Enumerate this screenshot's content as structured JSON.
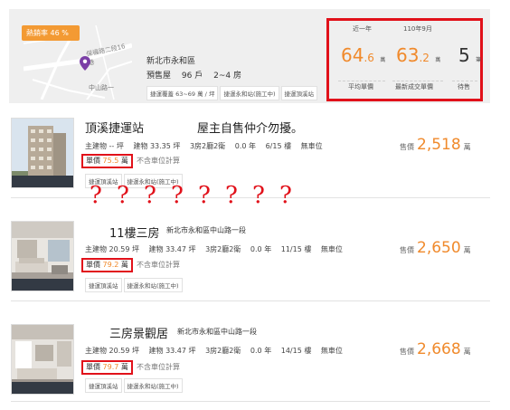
{
  "header": {
    "heat_rate": "熱銷率 46 %",
    "map_road_1": "中山路一",
    "map_road_2": "保福路二段16巷",
    "community_name": "新北市永和區",
    "community_info": [
      "預售屋",
      "96 戶",
      "2~4 房"
    ],
    "community_tags": [
      "捷運覆蓋 63~69 萬 / 坪",
      "捷運永和站(施工中)",
      "捷運頂溪站"
    ],
    "stats": {
      "period_year": "近一年",
      "period_month": "110年9月",
      "avg_price_int": "64",
      "avg_price_dec": ".6",
      "avg_price_unit": "萬",
      "avg_price_label": "平均單價",
      "latest_price_int": "63",
      "latest_price_dec": ".2",
      "latest_price_unit": "萬",
      "latest_price_label": "最新成交單價",
      "for_sale_count": "5",
      "for_sale_unit": "筆",
      "for_sale_label": "待售"
    }
  },
  "question_marks": [
    "?",
    "?",
    "?",
    "?",
    "?",
    "?",
    "?",
    "?"
  ],
  "listings": [
    {
      "title": "頂溪捷運站",
      "subtitle": "屋主自售仲介勿擾。",
      "address": "",
      "specs": [
        "主建物 -- 坪",
        "建物 33.35 坪",
        "3房2廳2衛",
        "0.0 年",
        "6/15 樓",
        "無車位"
      ],
      "unit_price_label": "單價",
      "unit_price_value": "75.5",
      "unit_price_unit": "萬",
      "exclude_note": "不含車位計算",
      "tags": [
        "捷運頂溪站",
        "捷運永和站(施工中)"
      ],
      "price_prefix": "售價",
      "price": "2,518",
      "price_unit": "萬"
    },
    {
      "title": "11樓三房",
      "subtitle": "",
      "address": "新北市永和區中山路一段",
      "specs": [
        "主建物 20.59 坪",
        "建物 33.47 坪",
        "3房2廳2衛",
        "0.0 年",
        "11/15 樓",
        "無車位"
      ],
      "unit_price_label": "單價",
      "unit_price_value": "79.2",
      "unit_price_unit": "萬",
      "exclude_note": "不含車位計算",
      "tags": [
        "捷運頂溪站",
        "捷運永和站(施工中)"
      ],
      "price_prefix": "售價",
      "price": "2,650",
      "price_unit": "萬"
    },
    {
      "title": "三房景觀居",
      "subtitle": "",
      "address": "新北市永和區中山路一段",
      "specs": [
        "主建物 20.59 坪",
        "建物 33.47 坪",
        "3房2廳2衛",
        "0.0 年",
        "14/15 樓",
        "無車位"
      ],
      "unit_price_label": "單價",
      "unit_price_value": "79.7",
      "unit_price_unit": "萬",
      "exclude_note": "不含車位計算",
      "tags": [
        "捷運頂溪站",
        "捷運永和站(施工中)"
      ],
      "price_prefix": "售價",
      "price": "2,668",
      "price_unit": "萬"
    }
  ],
  "colors": {
    "accent_orange": "#f08a2c",
    "highlight_red": "#e1111a",
    "badge_orange": "#f39a33",
    "map_pin": "#7b3fa6"
  }
}
